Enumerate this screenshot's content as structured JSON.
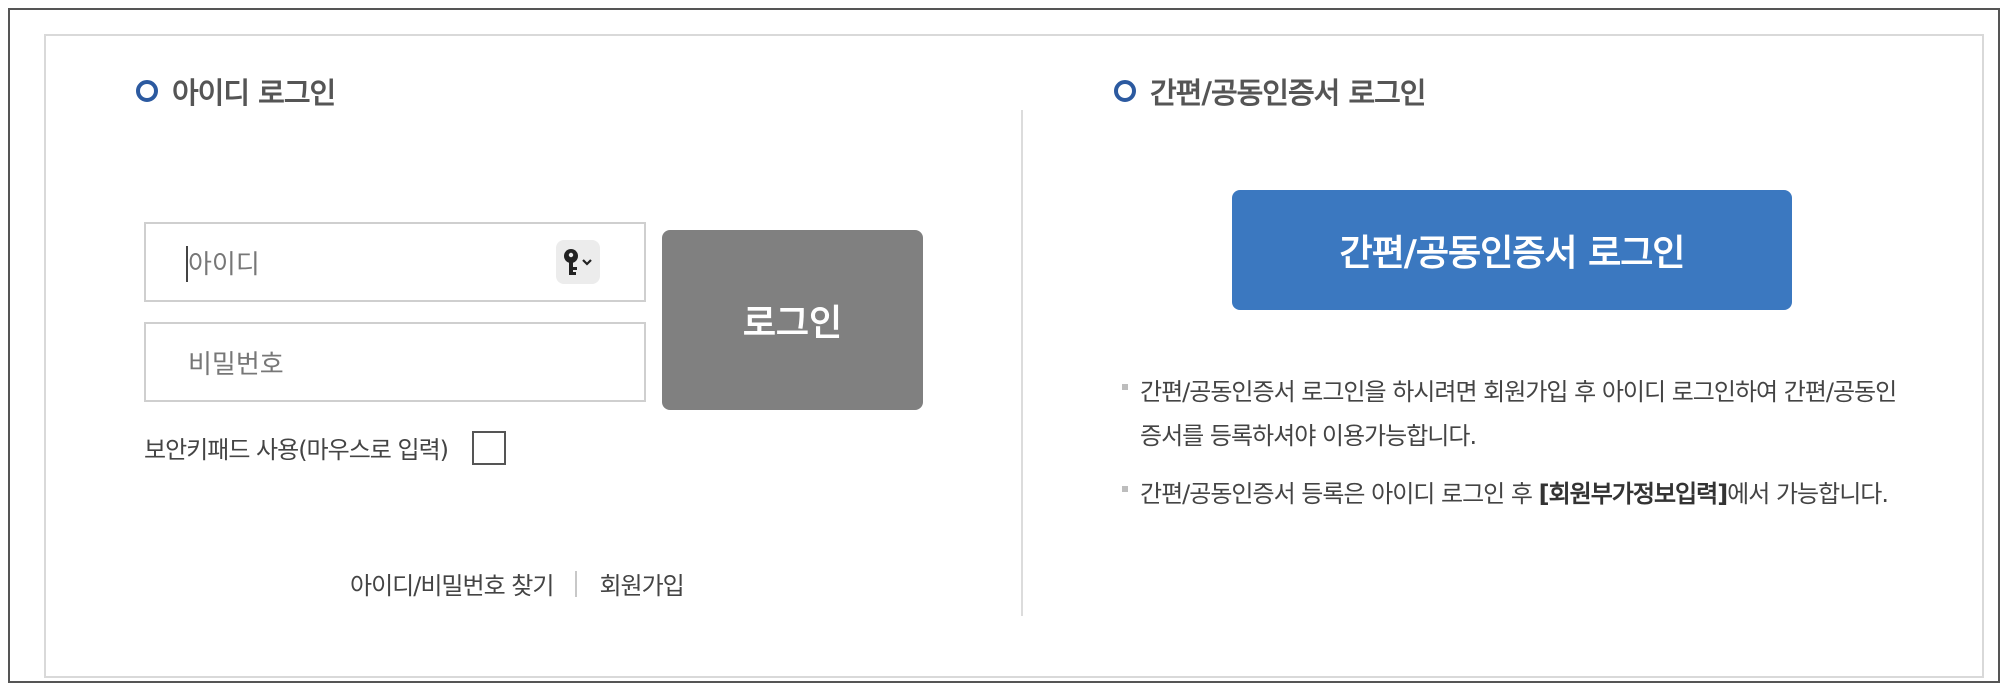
{
  "id_login": {
    "title": "아이디 로그인",
    "id_placeholder": "아이디",
    "password_placeholder": "비밀번호",
    "login_button": "로그인",
    "secure_keypad_label": "보안키패드 사용(마우스로 입력)",
    "find_link": "아이디/비밀번호 찾기",
    "signup_link": "회원가입"
  },
  "cert_login": {
    "title": "간편/공동인증서 로그인",
    "button": "간편/공동인증서 로그인",
    "note1": "간편/공동인증서 로그인을 하시려면 회원가입 후 아이디 로그인하여 간편/공동인증서를 등록하셔야 이용가능합니다.",
    "note2_prefix": "간편/공동인증서 등록은 아이디 로그인 후 ",
    "note2_bold": "[회원부가정보입력]",
    "note2_suffix": "에서 가능합니다."
  },
  "colors": {
    "accent": "#3b78c0",
    "ring": "#2c5aa0",
    "login_button": "#808080"
  },
  "icons": {
    "key": "key-icon",
    "chevron": "chevron-down-icon",
    "section_marker": "circle-icon"
  }
}
